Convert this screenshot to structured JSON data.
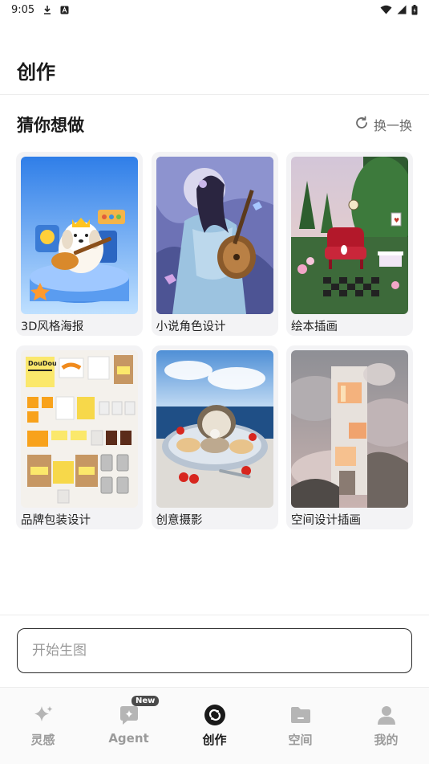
{
  "status_bar": {
    "time": "9:05",
    "icons": [
      "download-icon",
      "a-box-icon",
      "wifi-icon",
      "signal-icon",
      "battery-icon"
    ]
  },
  "header": {
    "title": "创作"
  },
  "section": {
    "title": "猜你想做",
    "refresh_label": "换一换"
  },
  "cards": [
    {
      "label": "3D风格海报"
    },
    {
      "label": "小说角色设计"
    },
    {
      "label": "绘本插画"
    },
    {
      "label": "品牌包装设计"
    },
    {
      "label": "创意摄影"
    },
    {
      "label": "空间设计插画"
    }
  ],
  "prompt": {
    "placeholder": "开始生图",
    "value": ""
  },
  "bottom_nav": {
    "items": [
      {
        "label": "灵感",
        "icon": "sparkle-icon",
        "active": false
      },
      {
        "label": "Agent",
        "icon": "agent-chat-icon",
        "active": false,
        "badge": "New"
      },
      {
        "label": "创作",
        "icon": "create-icon",
        "active": true
      },
      {
        "label": "空间",
        "icon": "folder-icon",
        "active": false
      },
      {
        "label": "我的",
        "icon": "person-icon",
        "active": false
      }
    ]
  },
  "colors": {
    "active": "#1a1a1a",
    "inactive": "#9b9b9b",
    "card_bg": "#f3f3f5"
  }
}
